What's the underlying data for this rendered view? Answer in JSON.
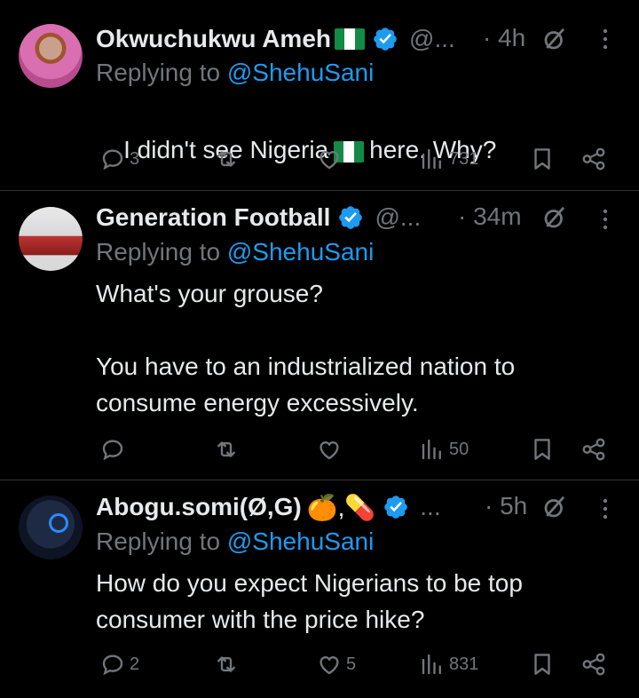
{
  "tweets": [
    {
      "name": "Okwuchukwu Ameh",
      "handle": "@...",
      "time": "· 4h",
      "replying_prefix": "Replying to",
      "replying_to": "@ShehuSani",
      "text_before_flag": "I didn't see Nigeria",
      "text_after_flag": "here. Why?",
      "replies": "3",
      "retweets": "",
      "likes": "",
      "views": "731"
    },
    {
      "name": "Generation Football",
      "handle": "@...",
      "time": "· 34m",
      "replying_prefix": "Replying to",
      "replying_to": "@ShehuSani",
      "text": "What's your grouse?\n\nYou have to an industrialized nation to consume energy excessively.",
      "replies": "",
      "retweets": "",
      "likes": "",
      "views": "50"
    },
    {
      "name": "Abogu.somi(Ø,G)",
      "name_emojis": "🍊,💊",
      "handle": "...",
      "time": "· 5h",
      "replying_prefix": "Replying to",
      "replying_to": "@ShehuSani",
      "text": "How do you expect Nigerians to be top consumer with the price hike?",
      "replies": "2",
      "retweets": "",
      "likes": "5",
      "views": "831"
    }
  ],
  "colors": {
    "background": "#000000",
    "text": "#e7e9ea",
    "muted": "#71767b",
    "accent": "#1d9bf0",
    "divider": "#2f3336"
  },
  "icons": [
    "verified-badge-icon",
    "grok-icon",
    "more-icon",
    "reply-icon",
    "retweet-icon",
    "like-icon",
    "views-icon",
    "bookmark-icon",
    "share-icon"
  ]
}
